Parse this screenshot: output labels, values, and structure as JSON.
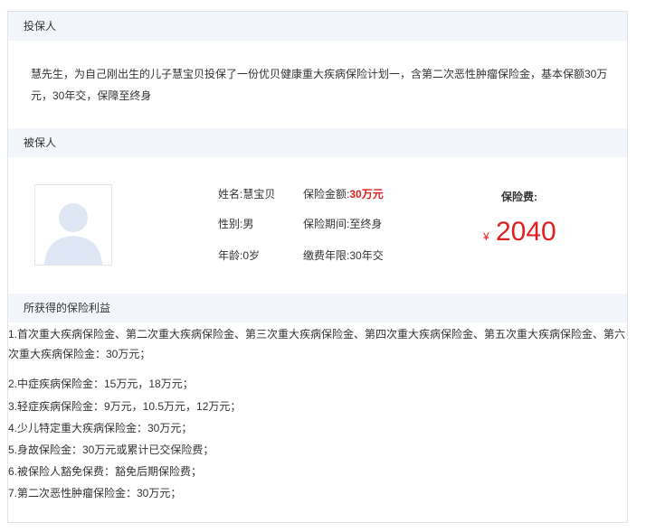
{
  "policyholder": {
    "heading": "投保人",
    "description": "慧先生，为自己刚出生的儿子慧宝贝投保了一份优贝健康重大疾病保险计划一，含第二次恶性肿瘤保险金，基本保额30万元，30年交，保障至终身"
  },
  "insured": {
    "heading": "被保人",
    "avatar_icon": "user-placeholder-icon",
    "name_label": "姓名:",
    "name_value": "慧宝贝",
    "gender_label": "性别:",
    "gender_value": "男",
    "age_label": "年龄:",
    "age_value": "0岁",
    "amount_label": "保险金额:",
    "amount_value": "30万元",
    "period_label": "保险期间:",
    "period_value": "至终身",
    "payment_label": "缴费年限:",
    "payment_value": "30年交",
    "fee_label": "保险费:",
    "fee_currency": "¥",
    "fee_amount": "2040"
  },
  "benefits": {
    "heading": "所获得的保险利益",
    "items": [
      "1.首次重大疾病保险金、第二次重大疾病保险金、第三次重大疾病保险金、第四次重大疾病保险金、第五次重大疾病保险金、第六次重大疾病保险金：30万元；",
      "2.中症疾病保险金：15万元，18万元；",
      "3.轻症疾病保险金：9万元，10.5万元，12万元；",
      "4.少儿特定重大疾病保险金：30万元；",
      "5.身故保险金：30万元或累计已交保险费；",
      "6.被保险人豁免保费：豁免后期保险费；",
      "7.第二次恶性肿瘤保险金：30万元；"
    ]
  },
  "colors": {
    "accent_red": "#e02020",
    "header_bg": "#f2f6fb",
    "avatar": "#dfe7f5"
  }
}
